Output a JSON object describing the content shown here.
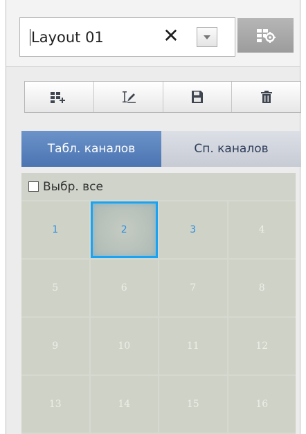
{
  "layout": {
    "name": "Layout 01",
    "clear_symbol": "✕"
  },
  "toolbar": {
    "buttons": [
      {
        "icon": "add-layout-icon"
      },
      {
        "icon": "rename-icon"
      },
      {
        "icon": "save-icon"
      },
      {
        "icon": "delete-icon"
      }
    ]
  },
  "tabs": [
    {
      "label": "Табл. каналов",
      "active": true
    },
    {
      "label": "Сп. каналов",
      "active": false
    }
  ],
  "select_all": {
    "label": "Выбр. все",
    "checked": false
  },
  "channels": [
    {
      "label": "1",
      "state": "active"
    },
    {
      "label": "2",
      "state": "selected"
    },
    {
      "label": "3",
      "state": "active"
    },
    {
      "label": "4",
      "state": "inactive"
    },
    {
      "label": "5",
      "state": "inactive"
    },
    {
      "label": "6",
      "state": "inactive"
    },
    {
      "label": "7",
      "state": "inactive"
    },
    {
      "label": "8",
      "state": "inactive"
    },
    {
      "label": "9",
      "state": "inactive"
    },
    {
      "label": "10",
      "state": "inactive"
    },
    {
      "label": "11",
      "state": "inactive"
    },
    {
      "label": "12",
      "state": "inactive"
    },
    {
      "label": "13",
      "state": "inactive"
    },
    {
      "label": "14",
      "state": "inactive"
    },
    {
      "label": "15",
      "state": "inactive"
    },
    {
      "label": "16",
      "state": "inactive"
    }
  ],
  "colors": {
    "accent": "#1aa3f2",
    "active_tab": "#5a82bd",
    "channel_active_text": "#2e8de0"
  }
}
